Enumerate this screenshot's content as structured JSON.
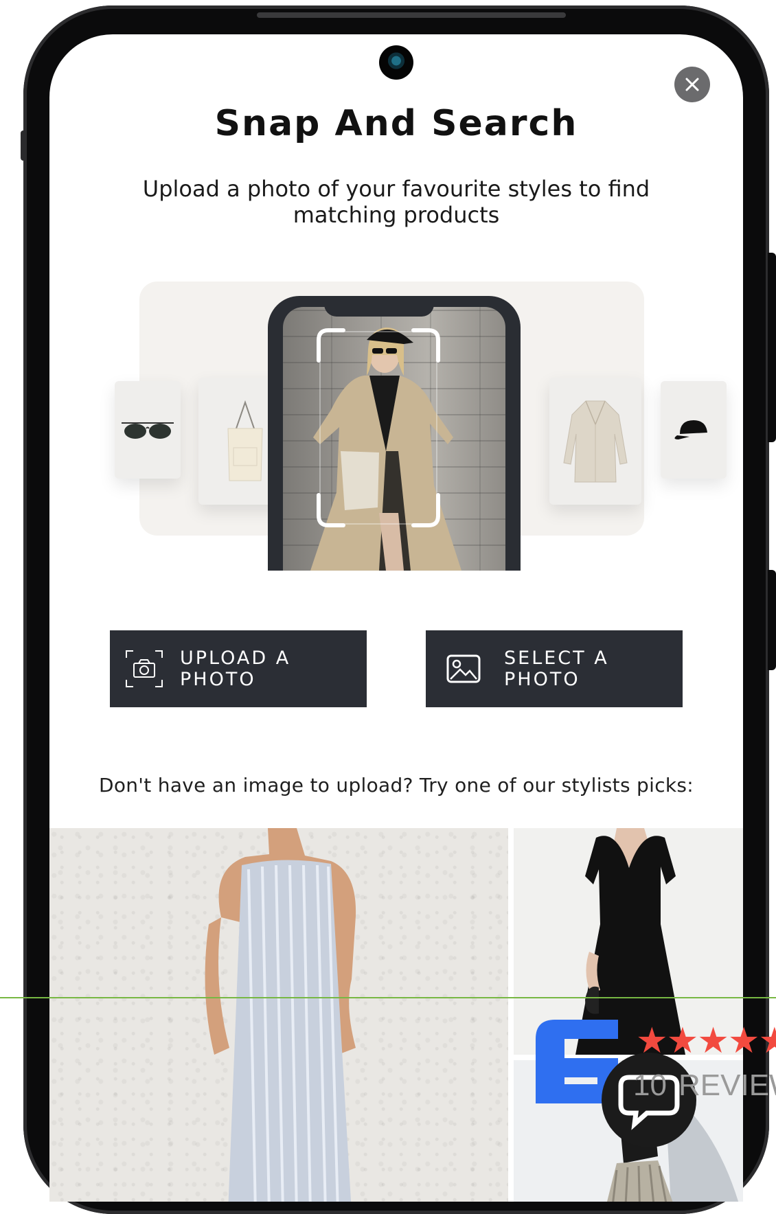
{
  "modal": {
    "title": "Snap And Search",
    "subtitle": "Upload a photo of your favourite styles to find matching products",
    "close_icon": "close-icon"
  },
  "actions": {
    "upload_label": "UPLOAD A PHOTO",
    "upload_icon": "camera-icon",
    "select_label": "SELECT A PHOTO",
    "select_icon": "image-icon"
  },
  "picks": {
    "prompt": "Don't have an image to upload? Try one of our stylists picks:"
  },
  "reviews_badge": {
    "rating_stars": 5,
    "count": "10",
    "label": "REVIEWS"
  },
  "colors": {
    "button_bg": "#2b2e35",
    "star": "#f24a3f",
    "logo_blue": "#2f6ff0",
    "guide_line": "#77b843"
  }
}
